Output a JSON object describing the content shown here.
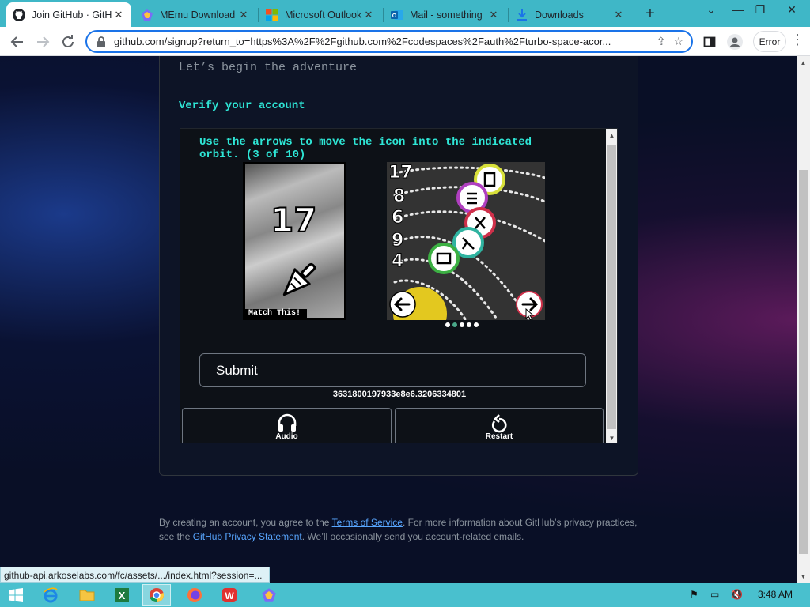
{
  "browser": {
    "tabs": [
      {
        "label": "Join GitHub · GitHub",
        "icon": "github-icon",
        "active": true
      },
      {
        "label": "MEmu Download",
        "icon": "memu-icon",
        "active": false
      },
      {
        "label": "Microsoft Outlook",
        "icon": "microsoft-icon",
        "active": false
      },
      {
        "label": "Mail - something",
        "icon": "outlook-icon",
        "active": false
      },
      {
        "label": "Downloads",
        "icon": "download-icon",
        "active": false
      }
    ],
    "url": "github.com/signup?return_to=https%3A%2F%2Fgithub.com%2Fcodespaces%2Fauth%2Fturbo-space-acor...",
    "profile_status": "Error"
  },
  "signup": {
    "subtitle": "Let’s begin the adventure",
    "verify_heading": "Verify your account",
    "captcha": {
      "instruction": "Use the arrows to move the icon into the indicated orbit. (3 of 10)",
      "match_number": "17",
      "match_label": "Match This!",
      "orbit_numbers": [
        "17",
        "8",
        "6",
        "9",
        "4"
      ],
      "current_step": 2,
      "total_steps": 5,
      "submit_label": "Submit",
      "session_token": "3631800197933e8e6.3206334801",
      "audio_label": "Audio",
      "restart_label": "Restart"
    },
    "legal": {
      "prefix": "By creating an account, you agree to the ",
      "terms_link": "Terms of Service",
      "middle": ". For more information about GitHub’s privacy practices, see the ",
      "privacy_link": "GitHub Privacy Statement",
      "suffix": ". We’ll occasionally send you account-related emails."
    }
  },
  "status_bar": {
    "url": "github-api.arkoselabs.com/fc/assets/.../index.html?session=..."
  },
  "taskbar": {
    "items": [
      "start-icon",
      "ie-icon",
      "file-explorer-icon",
      "excel-icon",
      "chrome-icon",
      "firefox-icon",
      "wps-icon",
      "memu-icon"
    ],
    "clock": "3:48 AM"
  },
  "colors": {
    "accent": "#2ee6d6",
    "link": "#58a6ff",
    "tab_strip": "#3fb7c7",
    "taskbar": "#49c0ce"
  }
}
